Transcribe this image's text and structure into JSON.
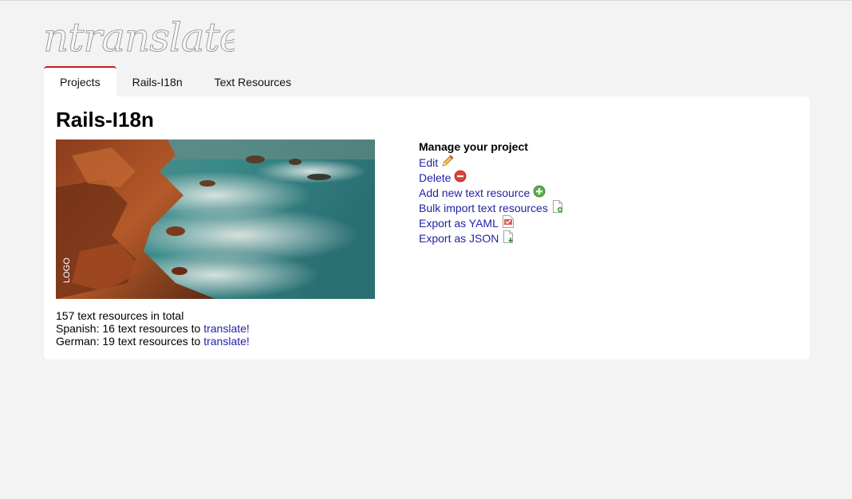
{
  "app": {
    "logo_text": "ntranslate"
  },
  "tabs": [
    {
      "label": "Projects",
      "active": true
    },
    {
      "label": "Rails-I18n",
      "active": false
    },
    {
      "label": "Text Resources",
      "active": false
    }
  ],
  "page": {
    "title": "Rails-I18n",
    "image_caption": "LOGO"
  },
  "stats": {
    "total": "157 text resources in total",
    "spanish_prefix": "Spanish: 16 text resources to ",
    "german_prefix": "German: 19 text resources to ",
    "translate_link": "translate!"
  },
  "manage": {
    "title": "Manage your project",
    "items": [
      {
        "label": "Edit",
        "icon": "pencil-icon"
      },
      {
        "label": "Delete",
        "icon": "delete-icon"
      },
      {
        "label": "Add new text resource",
        "icon": "add-icon"
      },
      {
        "label": "Bulk import text resources",
        "icon": "page-import-icon"
      },
      {
        "label": "Export as YAML",
        "icon": "page-yaml-icon"
      },
      {
        "label": "Export as JSON",
        "icon": "page-export-icon"
      }
    ]
  },
  "colors": {
    "link": "#2222aa",
    "active_tab_border": "#cc1a1a",
    "background": "#f3f3f3"
  }
}
